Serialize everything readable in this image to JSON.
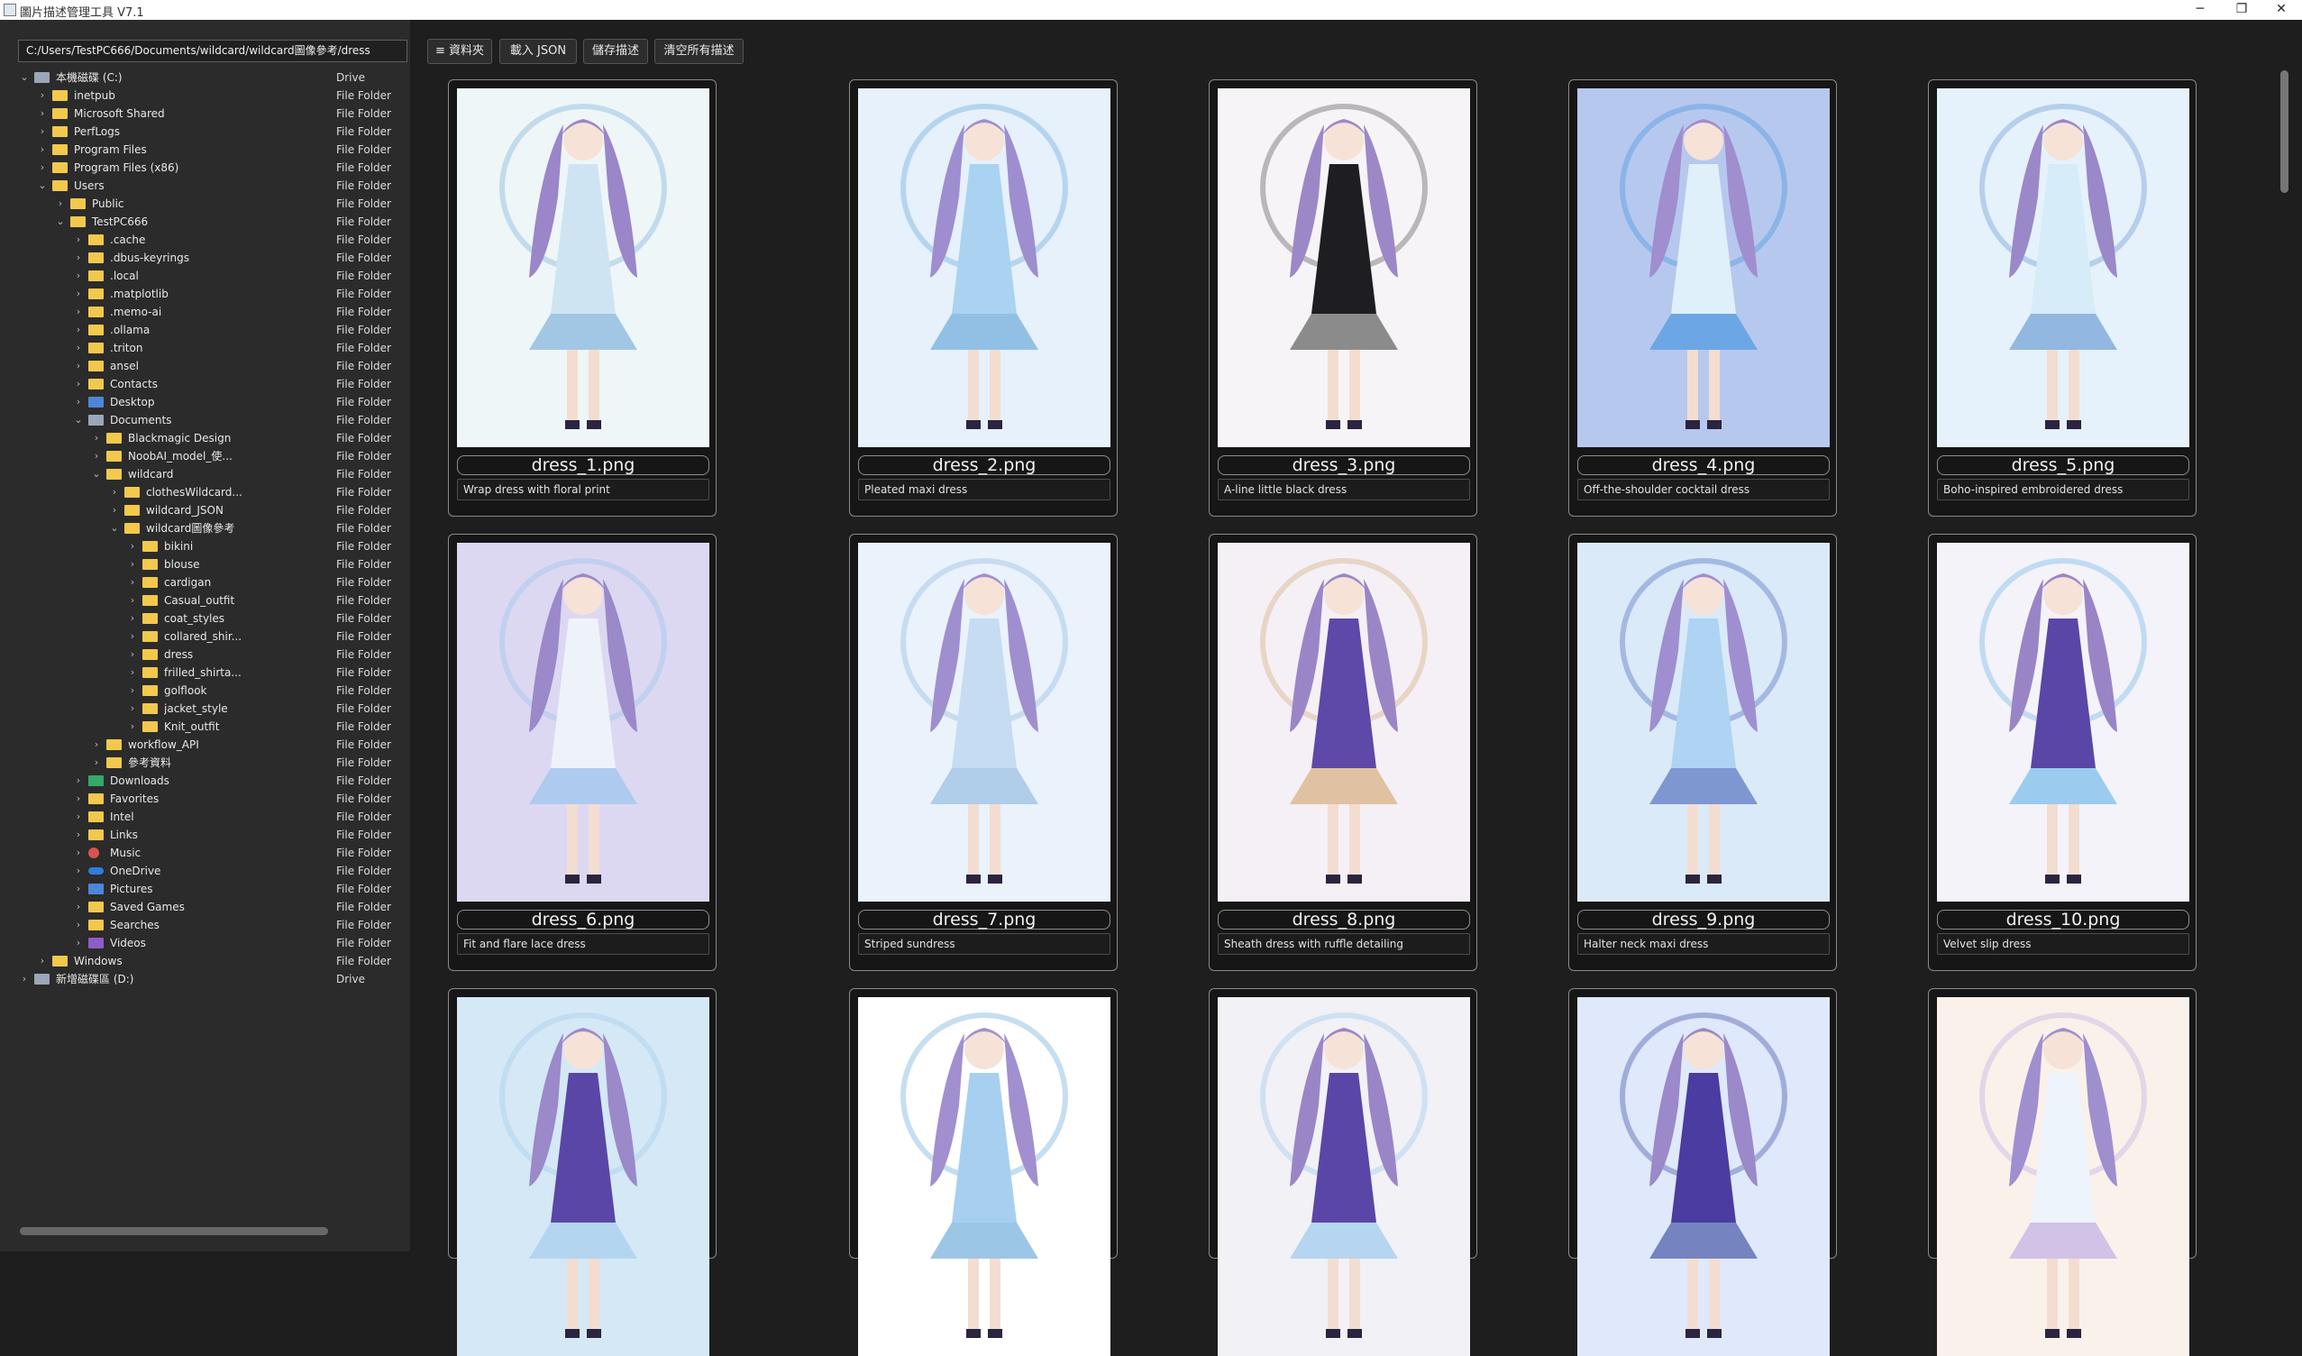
{
  "window": {
    "title": "圖片描述管理工具 V7.1",
    "minimize": "─",
    "maximize": "❐",
    "close": "✕"
  },
  "path": "C:/Users/TestPC666/Documents/wildcard/wildcard圖像參考/dress",
  "toolbar": {
    "folder_label": "≡ 資料夾",
    "load_json_label": "載入 JSON",
    "save_label": "儲存描述",
    "clear_label": "清空所有描述"
  },
  "tree": [
    {
      "depth": 0,
      "expanded": true,
      "icon": "drive",
      "name": "本機磁碟 (C:)",
      "type": "Drive"
    },
    {
      "depth": 1,
      "expanded": false,
      "icon": "folder",
      "name": "inetpub",
      "type": "File Folder"
    },
    {
      "depth": 1,
      "expanded": false,
      "icon": "folder",
      "name": "Microsoft Shared",
      "type": "File Folder"
    },
    {
      "depth": 1,
      "expanded": false,
      "icon": "folder",
      "name": "PerfLogs",
      "type": "File Folder"
    },
    {
      "depth": 1,
      "expanded": false,
      "icon": "folder",
      "name": "Program Files",
      "type": "File Folder"
    },
    {
      "depth": 1,
      "expanded": false,
      "icon": "folder",
      "name": "Program Files (x86)",
      "type": "File Folder"
    },
    {
      "depth": 1,
      "expanded": true,
      "icon": "folder",
      "name": "Users",
      "type": "File Folder"
    },
    {
      "depth": 2,
      "expanded": false,
      "icon": "folder",
      "name": "Public",
      "type": "File Folder"
    },
    {
      "depth": 2,
      "expanded": true,
      "icon": "folder",
      "name": "TestPC666",
      "type": "File Folder"
    },
    {
      "depth": 3,
      "expanded": false,
      "icon": "folder",
      "name": ".cache",
      "type": "File Folder"
    },
    {
      "depth": 3,
      "expanded": false,
      "icon": "folder",
      "name": ".dbus-keyrings",
      "type": "File Folder"
    },
    {
      "depth": 3,
      "expanded": false,
      "icon": "folder",
      "name": ".local",
      "type": "File Folder"
    },
    {
      "depth": 3,
      "expanded": false,
      "icon": "folder",
      "name": ".matplotlib",
      "type": "File Folder"
    },
    {
      "depth": 3,
      "expanded": false,
      "icon": "folder",
      "name": ".memo-ai",
      "type": "File Folder"
    },
    {
      "depth": 3,
      "expanded": false,
      "icon": "folder",
      "name": ".ollama",
      "type": "File Folder"
    },
    {
      "depth": 3,
      "expanded": false,
      "icon": "folder",
      "name": ".triton",
      "type": "File Folder"
    },
    {
      "depth": 3,
      "expanded": false,
      "icon": "folder",
      "name": "ansel",
      "type": "File Folder"
    },
    {
      "depth": 3,
      "expanded": false,
      "icon": "folder",
      "name": "Contacts",
      "type": "File Folder"
    },
    {
      "depth": 3,
      "expanded": false,
      "icon": "special",
      "name": "Desktop",
      "type": "File Folder"
    },
    {
      "depth": 3,
      "expanded": true,
      "icon": "drive",
      "name": "Documents",
      "type": "File Folder"
    },
    {
      "depth": 4,
      "expanded": false,
      "icon": "folder",
      "name": "Blackmagic Design",
      "type": "File Folder"
    },
    {
      "depth": 4,
      "expanded": false,
      "icon": "folder",
      "name": "NoobAI_model_使...",
      "type": "File Folder"
    },
    {
      "depth": 4,
      "expanded": true,
      "icon": "folder",
      "name": "wildcard",
      "type": "File Folder"
    },
    {
      "depth": 5,
      "expanded": false,
      "icon": "folder",
      "name": "clothesWildcard...",
      "type": "File Folder"
    },
    {
      "depth": 5,
      "expanded": false,
      "icon": "folder",
      "name": "wildcard_JSON",
      "type": "File Folder"
    },
    {
      "depth": 5,
      "expanded": true,
      "icon": "folder",
      "name": "wildcard圖像參考",
      "type": "File Folder"
    },
    {
      "depth": 6,
      "expanded": false,
      "icon": "folder",
      "name": "bikini",
      "type": "File Folder"
    },
    {
      "depth": 6,
      "expanded": false,
      "icon": "folder",
      "name": "blouse",
      "type": "File Folder"
    },
    {
      "depth": 6,
      "expanded": false,
      "icon": "folder",
      "name": "cardigan",
      "type": "File Folder"
    },
    {
      "depth": 6,
      "expanded": false,
      "icon": "folder",
      "name": "Casual_outfit",
      "type": "File Folder"
    },
    {
      "depth": 6,
      "expanded": false,
      "icon": "folder",
      "name": "coat_styles",
      "type": "File Folder"
    },
    {
      "depth": 6,
      "expanded": false,
      "icon": "folder",
      "name": "collared_shir...",
      "type": "File Folder"
    },
    {
      "depth": 6,
      "expanded": false,
      "icon": "folder",
      "name": "dress",
      "type": "File Folder"
    },
    {
      "depth": 6,
      "expanded": false,
      "icon": "folder",
      "name": "frilled_shirta...",
      "type": "File Folder"
    },
    {
      "depth": 6,
      "expanded": false,
      "icon": "folder",
      "name": "golflook",
      "type": "File Folder"
    },
    {
      "depth": 6,
      "expanded": false,
      "icon": "folder",
      "name": "jacket_style",
      "type": "File Folder"
    },
    {
      "depth": 6,
      "expanded": false,
      "icon": "folder",
      "name": "Knit_outfit",
      "type": "File Folder"
    },
    {
      "depth": 4,
      "expanded": false,
      "icon": "folder",
      "name": "workflow_API",
      "type": "File Folder"
    },
    {
      "depth": 4,
      "expanded": false,
      "icon": "folder",
      "name": "參考資料",
      "type": "File Folder"
    },
    {
      "depth": 3,
      "expanded": false,
      "icon": "download",
      "name": "Downloads",
      "type": "File Folder"
    },
    {
      "depth": 3,
      "expanded": false,
      "icon": "folder",
      "name": "Favorites",
      "type": "File Folder"
    },
    {
      "depth": 3,
      "expanded": false,
      "icon": "folder",
      "name": "Intel",
      "type": "File Folder"
    },
    {
      "depth": 3,
      "expanded": false,
      "icon": "folder",
      "name": "Links",
      "type": "File Folder"
    },
    {
      "depth": 3,
      "expanded": false,
      "icon": "music",
      "name": "Music",
      "type": "File Folder"
    },
    {
      "depth": 3,
      "expanded": false,
      "icon": "cloud",
      "name": "OneDrive",
      "type": "File Folder"
    },
    {
      "depth": 3,
      "expanded": false,
      "icon": "special",
      "name": "Pictures",
      "type": "File Folder"
    },
    {
      "depth": 3,
      "expanded": false,
      "icon": "folder",
      "name": "Saved Games",
      "type": "File Folder"
    },
    {
      "depth": 3,
      "expanded": false,
      "icon": "folder",
      "name": "Searches",
      "type": "File Folder"
    },
    {
      "depth": 3,
      "expanded": false,
      "icon": "video",
      "name": "Videos",
      "type": "File Folder"
    },
    {
      "depth": 1,
      "expanded": false,
      "icon": "folder",
      "name": "Windows",
      "type": "File Folder"
    },
    {
      "depth": 0,
      "expanded": false,
      "icon": "drive",
      "name": "新增磁碟區 (D:)",
      "type": "Drive"
    }
  ],
  "images": [
    {
      "filename": "dress_1.png",
      "description": "Wrap dress with floral print",
      "bg": "#eef6f8",
      "hair": "#9a86c8",
      "dress": "#cfe4f2",
      "accent": "#6fa8d8"
    },
    {
      "filename": "dress_2.png",
      "description": "Pleated maxi dress",
      "bg": "#e6f1fb",
      "hair": "#9e8ed0",
      "dress": "#a9d3f0",
      "accent": "#5aa0d6"
    },
    {
      "filename": "dress_3.png",
      "description": "A-line little black dress",
      "bg": "#f7f4f8",
      "hair": "#9c88c6",
      "dress": "#1d1d22",
      "accent": "#444444"
    },
    {
      "filename": "dress_4.png",
      "description": "Off-the-shoulder cocktail dress",
      "bg": "#b7c8ee",
      "hair": "#a08ecf",
      "dress": "#dff0fb",
      "accent": "#3a8fe0"
    },
    {
      "filename": "dress_5.png",
      "description": "Boho-inspired embroidered dress",
      "bg": "#e6f2fb",
      "hair": "#9a88c8",
      "dress": "#d6ecf8",
      "accent": "#5a8fd0"
    },
    {
      "filename": "dress_6.png",
      "description": "Fit and flare lace dress",
      "bg": "#dcd8f2",
      "hair": "#9b89c9",
      "dress": "#eef3fa",
      "accent": "#8fc3ec"
    },
    {
      "filename": "dress_7.png",
      "description": "Striped sundress",
      "bg": "#eaf2fb",
      "hair": "#a08fcf",
      "dress": "#c6dcf2",
      "accent": "#88b4de"
    },
    {
      "filename": "dress_8.png",
      "description": "Sheath dress with ruffle detailing",
      "bg": "#f4f0f6",
      "hair": "#9a86c6",
      "dress": "#5e48a8",
      "accent": "#d2a36a"
    },
    {
      "filename": "dress_9.png",
      "description": "Halter neck maxi dress",
      "bg": "#dbeaf8",
      "hair": "#9f8fd0",
      "dress": "#aed3f3",
      "accent": "#3f5fb8"
    },
    {
      "filename": "dress_10.png",
      "description": "Velvet slip dress",
      "bg": "#f4f3f9",
      "hair": "#9985c6",
      "dress": "#5a46a6",
      "accent": "#5fb0e6"
    },
    {
      "filename": "",
      "description": "",
      "bg": "#d5e8f6",
      "hair": "#9b89c9",
      "dress": "#5a46a6",
      "accent": "#9cc8ec"
    },
    {
      "filename": "",
      "description": "",
      "bg": "#ffffff",
      "hair": "#a18fd0",
      "dress": "#a7d0f0",
      "accent": "#5aa0d6"
    },
    {
      "filename": "",
      "description": "",
      "bg": "#f1f1f6",
      "hair": "#9a86c6",
      "dress": "#5a46a6",
      "accent": "#8fc3ec"
    },
    {
      "filename": "",
      "description": "",
      "bg": "#dfe9fb",
      "hair": "#9b89c9",
      "dress": "#4a3ca0",
      "accent": "#2f3f9a"
    },
    {
      "filename": "",
      "description": "",
      "bg": "#faf1ea",
      "hair": "#a08fcf",
      "dress": "#eef4fb",
      "accent": "#b7a3e6"
    }
  ]
}
